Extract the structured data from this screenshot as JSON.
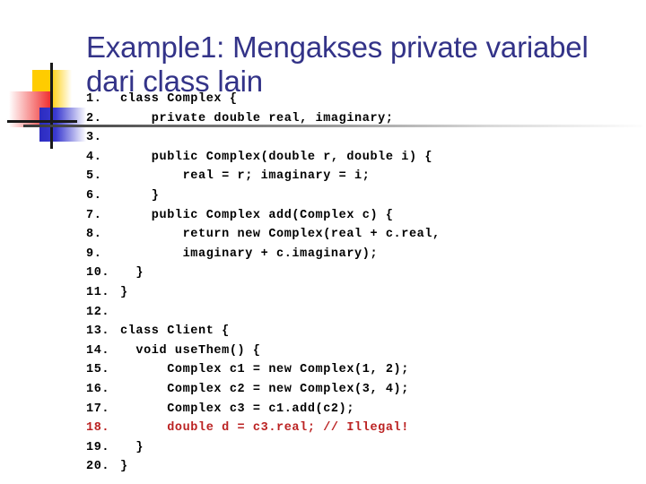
{
  "slide": {
    "title": "Example1: Mengakses private variabel dari class lain",
    "title_color": "#333388",
    "background_color": "#ffffff",
    "illegal_color": "#bb2222"
  },
  "decoration": {
    "name": "design-motif",
    "yellow": "#ffcc00",
    "red": "#f03030",
    "blue": "#2b2bc0",
    "rule": "#1a1a1a"
  },
  "divider": {
    "from": "#3a3a3a",
    "to": "#fdfdfd"
  },
  "code": {
    "lines": [
      {
        "n": "1.",
        "text": "class Complex {",
        "illegal": false
      },
      {
        "n": "2.",
        "text": "    private double real, imaginary;",
        "illegal": false
      },
      {
        "n": "3.",
        "text": "",
        "illegal": false
      },
      {
        "n": "4.",
        "text": "    public Complex(double r, double i) {",
        "illegal": false
      },
      {
        "n": "5.",
        "text": "        real = r; imaginary = i;",
        "illegal": false
      },
      {
        "n": "6.",
        "text": "    }",
        "illegal": false
      },
      {
        "n": "7.",
        "text": "    public Complex add(Complex c) {",
        "illegal": false
      },
      {
        "n": "8.",
        "text": "        return new Complex(real + c.real,",
        "illegal": false
      },
      {
        "n": "9.",
        "text": "        imaginary + c.imaginary);",
        "illegal": false
      },
      {
        "n": "10.",
        "text": "  }",
        "illegal": false
      },
      {
        "n": "11.",
        "text": "}",
        "illegal": false
      },
      {
        "n": "12.",
        "text": "",
        "illegal": false
      },
      {
        "n": "13.",
        "text": "class Client {",
        "illegal": false
      },
      {
        "n": "14.",
        "text": "  void useThem() {",
        "illegal": false
      },
      {
        "n": "15.",
        "text": "      Complex c1 = new Complex(1, 2);",
        "illegal": false
      },
      {
        "n": "16.",
        "text": "      Complex c2 = new Complex(3, 4);",
        "illegal": false
      },
      {
        "n": "17.",
        "text": "      Complex c3 = c1.add(c2);",
        "illegal": false
      },
      {
        "n": "18.",
        "text": "      double d = c3.real; // Illegal!",
        "illegal": true
      },
      {
        "n": "19.",
        "text": "  }",
        "illegal": false
      },
      {
        "n": "20.",
        "text": "}",
        "illegal": false
      }
    ]
  }
}
